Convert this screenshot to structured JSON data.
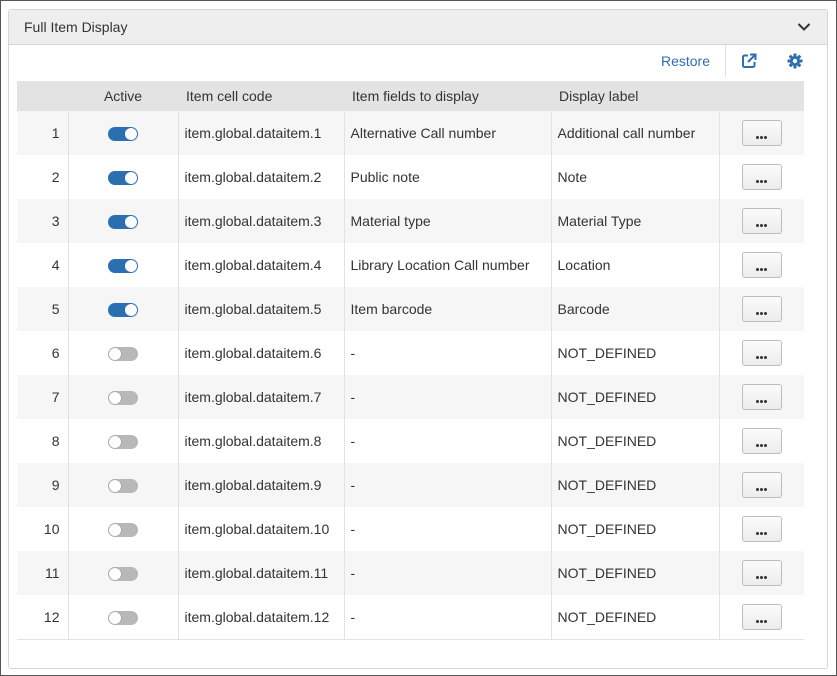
{
  "panel": {
    "title": "Full Item Display",
    "toolbar": {
      "restore_label": "Restore"
    }
  },
  "table": {
    "columns": [
      "",
      "Active",
      "Item cell code",
      "Item fields to display",
      "Display label",
      ""
    ],
    "rows": [
      {
        "num": "1",
        "active": true,
        "code": "item.global.dataitem.1",
        "field": "Alternative Call number",
        "label": "Additional call number"
      },
      {
        "num": "2",
        "active": true,
        "code": "item.global.dataitem.2",
        "field": "Public note",
        "label": "Note"
      },
      {
        "num": "3",
        "active": true,
        "code": "item.global.dataitem.3",
        "field": "Material type",
        "label": "Material Type"
      },
      {
        "num": "4",
        "active": true,
        "code": "item.global.dataitem.4",
        "field": "Library Location Call number",
        "label": "Location"
      },
      {
        "num": "5",
        "active": true,
        "code": "item.global.dataitem.5",
        "field": "Item barcode",
        "label": "Barcode"
      },
      {
        "num": "6",
        "active": false,
        "code": "item.global.dataitem.6",
        "field": "-",
        "label": "NOT_DEFINED"
      },
      {
        "num": "7",
        "active": false,
        "code": "item.global.dataitem.7",
        "field": "-",
        "label": "NOT_DEFINED"
      },
      {
        "num": "8",
        "active": false,
        "code": "item.global.dataitem.8",
        "field": "-",
        "label": "NOT_DEFINED"
      },
      {
        "num": "9",
        "active": false,
        "code": "item.global.dataitem.9",
        "field": "-",
        "label": "NOT_DEFINED"
      },
      {
        "num": "10",
        "active": false,
        "code": "item.global.dataitem.10",
        "field": "-",
        "label": "NOT_DEFINED"
      },
      {
        "num": "11",
        "active": false,
        "code": "item.global.dataitem.11",
        "field": "-",
        "label": "NOT_DEFINED"
      },
      {
        "num": "12",
        "active": false,
        "code": "item.global.dataitem.12",
        "field": "-",
        "label": "NOT_DEFINED"
      }
    ]
  },
  "icons": {
    "collapse": "chevron-down-icon",
    "open_new_window": "external-link-icon",
    "settings": "gear-icon",
    "row_actions": "ellipsis-icon"
  },
  "colors": {
    "accent": "#2c6fb0",
    "header_bg": "#eeeeee",
    "table_header_bg": "#e3e3e3",
    "toggle_off": "#b8b8b8"
  }
}
